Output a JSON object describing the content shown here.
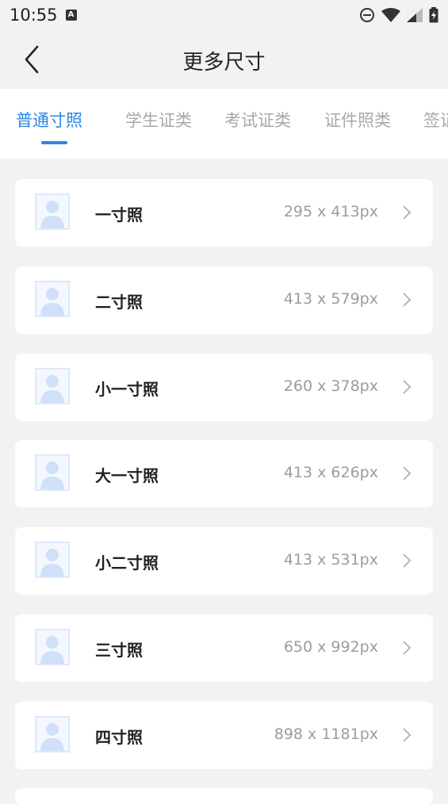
{
  "status_bar": {
    "time": "10:55",
    "a_badge": "A"
  },
  "nav": {
    "title": "更多尺寸"
  },
  "tabs": [
    {
      "label": "普通寸照",
      "active": true
    },
    {
      "label": "学生证类",
      "active": false
    },
    {
      "label": "考试证类",
      "active": false
    },
    {
      "label": "证件照类",
      "active": false
    },
    {
      "label": "签证",
      "active": false
    }
  ],
  "sizes": [
    {
      "name": "一寸照",
      "size": "295 x 413px"
    },
    {
      "name": "二寸照",
      "size": "413 x 579px"
    },
    {
      "name": "小一寸照",
      "size": "260 x 378px"
    },
    {
      "name": "大一寸照",
      "size": "413 x 626px"
    },
    {
      "name": "小二寸照",
      "size": "413 x 531px"
    },
    {
      "name": "三寸照",
      "size": "650 x 992px"
    },
    {
      "name": "四寸照",
      "size": "898 x 1181px"
    }
  ],
  "colors": {
    "accent": "#2f86e6",
    "background": "#f2f2f2"
  },
  "icons": [
    "back-chevron-icon",
    "do-not-disturb-icon",
    "wifi-icon",
    "signal-icon",
    "battery-charging-icon",
    "portrait-placeholder-icon",
    "chevron-right-icon"
  ]
}
